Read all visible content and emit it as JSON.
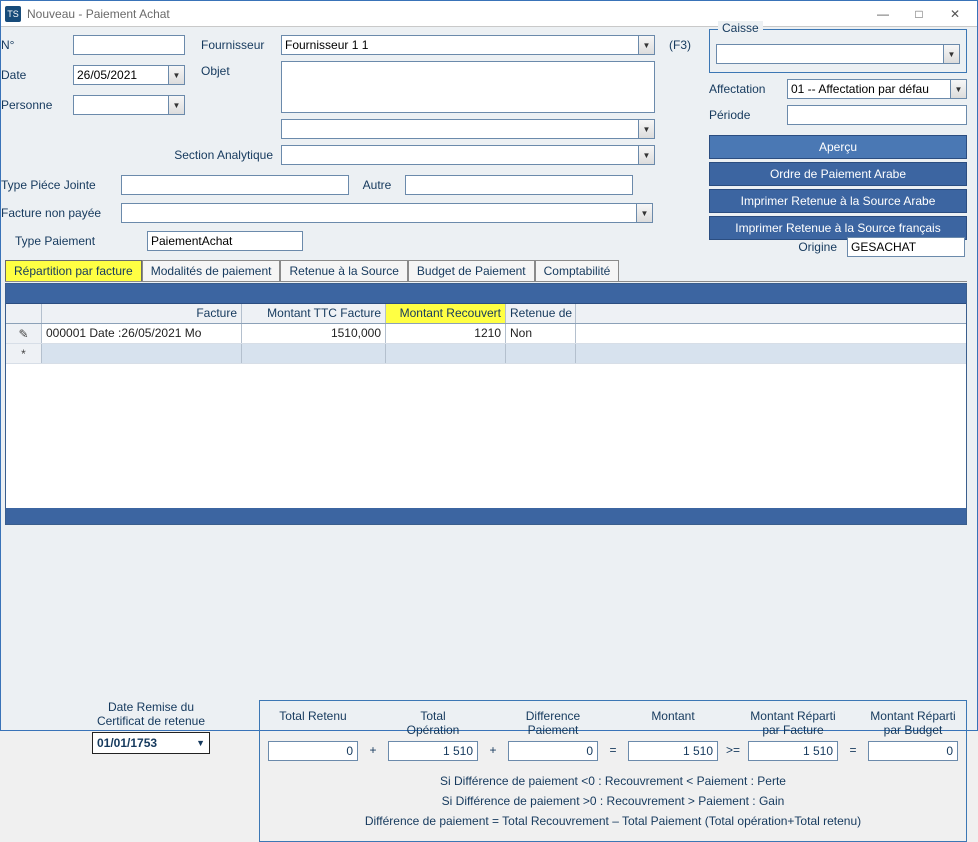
{
  "titlebar": {
    "app": "TS",
    "title": "Nouveau - Paiement Achat"
  },
  "labels": {
    "no": "N°",
    "date": "Date",
    "personne": "Personne",
    "fournisseur": "Fournisseur",
    "objet": "Objet",
    "section": "Section Analytique",
    "typePJ": "Type Piéce Jointe",
    "autre": "Autre",
    "factureNonPayee": "Facture non payée",
    "typePaiement": "Type Paiement",
    "f3": "(F3)",
    "caisse": "Caisse",
    "affectation": "Affectation",
    "periode": "Période",
    "origine": "Origine"
  },
  "values": {
    "no": "",
    "date": "26/05/2021",
    "personne": "",
    "fournisseur": "Fournisseur 1 1",
    "objet": "",
    "section": "",
    "typePJ": "",
    "autre": "",
    "factureNonPayee": "",
    "typePaiement": "PaiementAchat",
    "caisse": "",
    "affectation": "01 -- Affectation par défau",
    "periode": "",
    "origine": "GESACHAT"
  },
  "buttons": {
    "apercu": "Aperçu",
    "ordreArabe": "Ordre de Paiement Arabe",
    "retenueArabe": "Imprimer Retenue à la Source Arabe",
    "retenueFr": "Imprimer Retenue à la Source français"
  },
  "tabs": [
    "Répartition par facture",
    "Modalités de paiement",
    "Retenue à la Source",
    "Budget de Paiement",
    "Comptabilité"
  ],
  "grid": {
    "headers": {
      "facture": "Facture",
      "ttc": "Montant TTC Facture",
      "recouvert": "Montant Recouvert",
      "retenue": "Retenue de"
    },
    "rows": [
      {
        "marker": "✎",
        "facture": "000001 Date :26/05/2021 Mo",
        "ttc": "1510,000",
        "recouvert": "1210",
        "retenue": "Non"
      }
    ],
    "newrowMarker": "*"
  },
  "footer": {
    "certLabel1": "Date Remise du",
    "certLabel2": "Certificat de retenue",
    "certDate": "01/01/1753",
    "cols": {
      "totalRetenu": "Total Retenu",
      "totalOp1": "Total",
      "totalOp2": "Opération",
      "diff1": "Difference",
      "diff2": "Paiement",
      "montant": "Montant",
      "repFact1": "Montant Réparti",
      "repFact2": "par Facture",
      "repBud1": "Montant Réparti",
      "repBud2": "par Budget"
    },
    "vals": {
      "totalRetenu": "0",
      "totalOp": "1 510",
      "diff": "0",
      "montant": "1 510",
      "repFact": "1 510",
      "repBud": "0"
    },
    "note1": "Si Différence de paiement <0 : Recouvrement < Paiement : Perte",
    "note2": "Si Différence de paiement >0 : Recouvrement > Paiement : Gain",
    "note3": "Différence de paiement = Total Recouvrement – Total Paiement (Total opération+Total retenu)"
  }
}
